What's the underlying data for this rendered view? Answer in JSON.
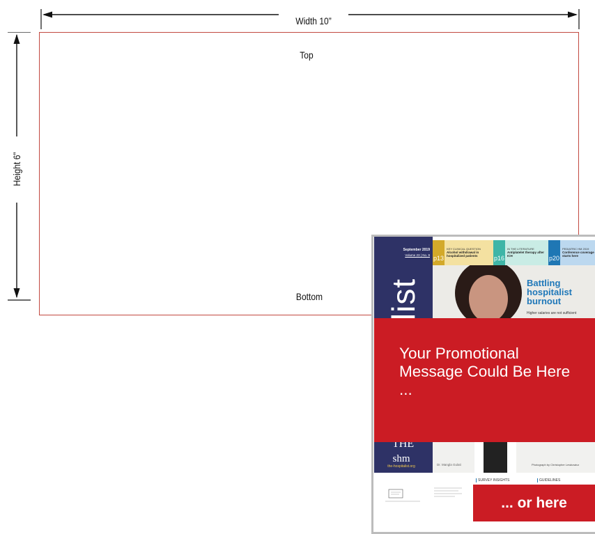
{
  "dimensions": {
    "width_label": "Width 10”",
    "height_label": "Height 6”",
    "top_label": "Top",
    "bottom_label": "Bottom"
  },
  "colors": {
    "safe_area_border": "#c2483f",
    "promo_red": "#cb1c24",
    "masthead_navy": "#2e3266",
    "tab_yellow": "#d3a92a",
    "tab_teal": "#3fb5a7",
    "tab_blue": "#1f77b4",
    "headline_blue": "#1f78b9"
  },
  "cover": {
    "date": "September 2019",
    "issue": "Volume 23 | No. 9",
    "masthead": "list",
    "tabs": [
      {
        "page": "p13",
        "kicker": "KEY CLINICAL QUESTION",
        "title": "Alcohol withdrawal in hospitalized patients"
      },
      {
        "page": "p16",
        "kicker": "IN THE LITERATURE",
        "title": "Antiplatelet therapy after ICH"
      },
      {
        "page": "p20",
        "kicker": "PEDIATRIC HM 2019",
        "title": "Conference coverage starts here"
      }
    ],
    "headline": "Battling hospitalist burnout",
    "subhead": "Higher salaries are not sufficient",
    "masthead_lower": "THE",
    "logo": "shm",
    "website": "the-hospitalist.org",
    "caption": "Dr. Mangla Gulati",
    "photo_credit": "Photograph by Christopher Lewkowicz",
    "bottom_tabs": [
      "SURVEY INSIGHTS",
      "GUIDELINES"
    ]
  },
  "promo_message": "Your Promotional Message Could Be Here ...",
  "promo_secondary": "... or here"
}
